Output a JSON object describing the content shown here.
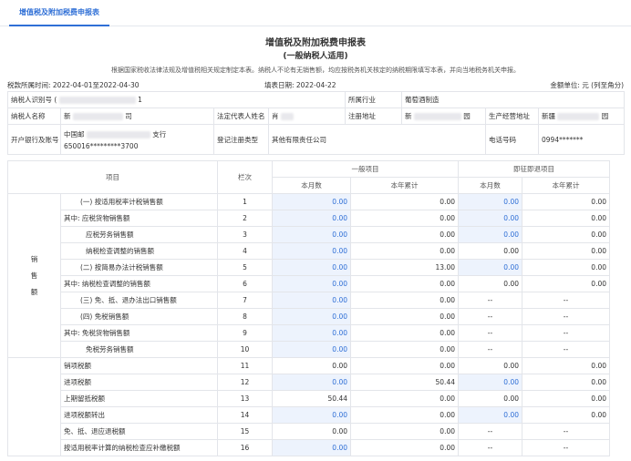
{
  "tab": {
    "label": "增值税及附加税费申报表"
  },
  "title": "增值税及附加税费申报表",
  "subtitle": "(一般纳税人适用)",
  "note": "根据国家税收法律法规及增值税相关规定制定本表。纳税人不论有无销售额，均应按税务机关核定的纳税期限填写本表，并向当地税务机关申报。",
  "meta": {
    "period_label": "税款所属时间: 2022-04-01至2022-04-30",
    "fill_date_label": "填表日期: 2022-04-22",
    "unit_label": "金额单位: 元 (列至角分)"
  },
  "info": {
    "taxpayer_id_label": "纳税人识别号 (",
    "taxpayer_id_tail": "1",
    "industry_label": "所属行业",
    "industry_value": "葡萄酒制造",
    "name_label": "纳税人名称",
    "name_head": "新",
    "name_tail": "司",
    "legal_rep_label": "法定代表人姓名",
    "legal_rep_value": "肖",
    "reg_addr_label": "注册地址",
    "reg_addr_head": "新",
    "reg_addr_tail": "园",
    "biz_addr_label": "生产经营地址",
    "biz_addr_head": "新疆",
    "biz_addr_tail": "园",
    "bank_label": "开户银行及账号",
    "bank_line1_head": "中国邮",
    "bank_line1_tail": "支行",
    "bank_line2": "650016*********3700",
    "reg_type_label": "登记注册类型",
    "reg_type_value": "其他有限责任公司",
    "phone_label": "电话号码",
    "phone_value": "0994*******"
  },
  "headers": {
    "item": "项目",
    "line": "栏次",
    "general": "一般项目",
    "immediate": "即征即退项目",
    "month": "本月数",
    "year": "本年累计"
  },
  "groups": {
    "sales": "销\n售\n额"
  },
  "rows": [
    {
      "label": "(一) 按适用税率计税销售额",
      "line": "1",
      "v": [
        "0.00",
        "0.00",
        "0.00",
        "0.00"
      ]
    },
    {
      "label": "其中: 应税货物销售额",
      "line": "2",
      "v": [
        "0.00",
        "0.00",
        "0.00",
        "0.00"
      ]
    },
    {
      "label": "应税劳务销售额",
      "line": "3",
      "v": [
        "0.00",
        "0.00",
        "0.00",
        "0.00"
      ]
    },
    {
      "label": "纳税检查调整的销售额",
      "line": "4",
      "v": [
        "0.00",
        "0.00",
        "0.00",
        "0.00"
      ]
    },
    {
      "label": "(二) 按简易办法计税销售额",
      "line": "5",
      "v": [
        "0.00",
        "13.00",
        "0.00",
        "0.00"
      ]
    },
    {
      "label": "其中: 纳税检查调整的销售额",
      "line": "6",
      "v": [
        "0.00",
        "0.00",
        "0.00",
        "0.00"
      ]
    },
    {
      "label": "(三) 免、抵、退办法出口销售额",
      "line": "7",
      "v": [
        "0.00",
        "0.00",
        "--",
        "--"
      ]
    },
    {
      "label": "(四) 免税销售额",
      "line": "8",
      "v": [
        "0.00",
        "0.00",
        "--",
        "--"
      ]
    },
    {
      "label": "其中: 免税货物销售额",
      "line": "9",
      "v": [
        "0.00",
        "0.00",
        "--",
        "--"
      ]
    },
    {
      "label": "免税劳务销售额",
      "line": "10",
      "v": [
        "0.00",
        "0.00",
        "--",
        "--"
      ]
    },
    {
      "label": "销项税额",
      "line": "11",
      "v": [
        "0.00",
        "0.00",
        "0.00",
        "0.00"
      ]
    },
    {
      "label": "进项税额",
      "line": "12",
      "v": [
        "0.00",
        "50.44",
        "0.00",
        "0.00"
      ]
    },
    {
      "label": "上期留抵税额",
      "line": "13",
      "v": [
        "50.44",
        "0.00",
        "0.00",
        "0.00"
      ]
    },
    {
      "label": "进项税额转出",
      "line": "14",
      "v": [
        "0.00",
        "0.00",
        "0.00",
        "0.00"
      ]
    },
    {
      "label": "免、抵、退应退税额",
      "line": "15",
      "v": [
        "0.00",
        "0.00",
        "--",
        "--"
      ]
    },
    {
      "label": "按适用税率计算的纳税检查应补缴税额",
      "line": "16",
      "v": [
        "0.00",
        "0.00",
        "--",
        "--"
      ]
    }
  ]
}
